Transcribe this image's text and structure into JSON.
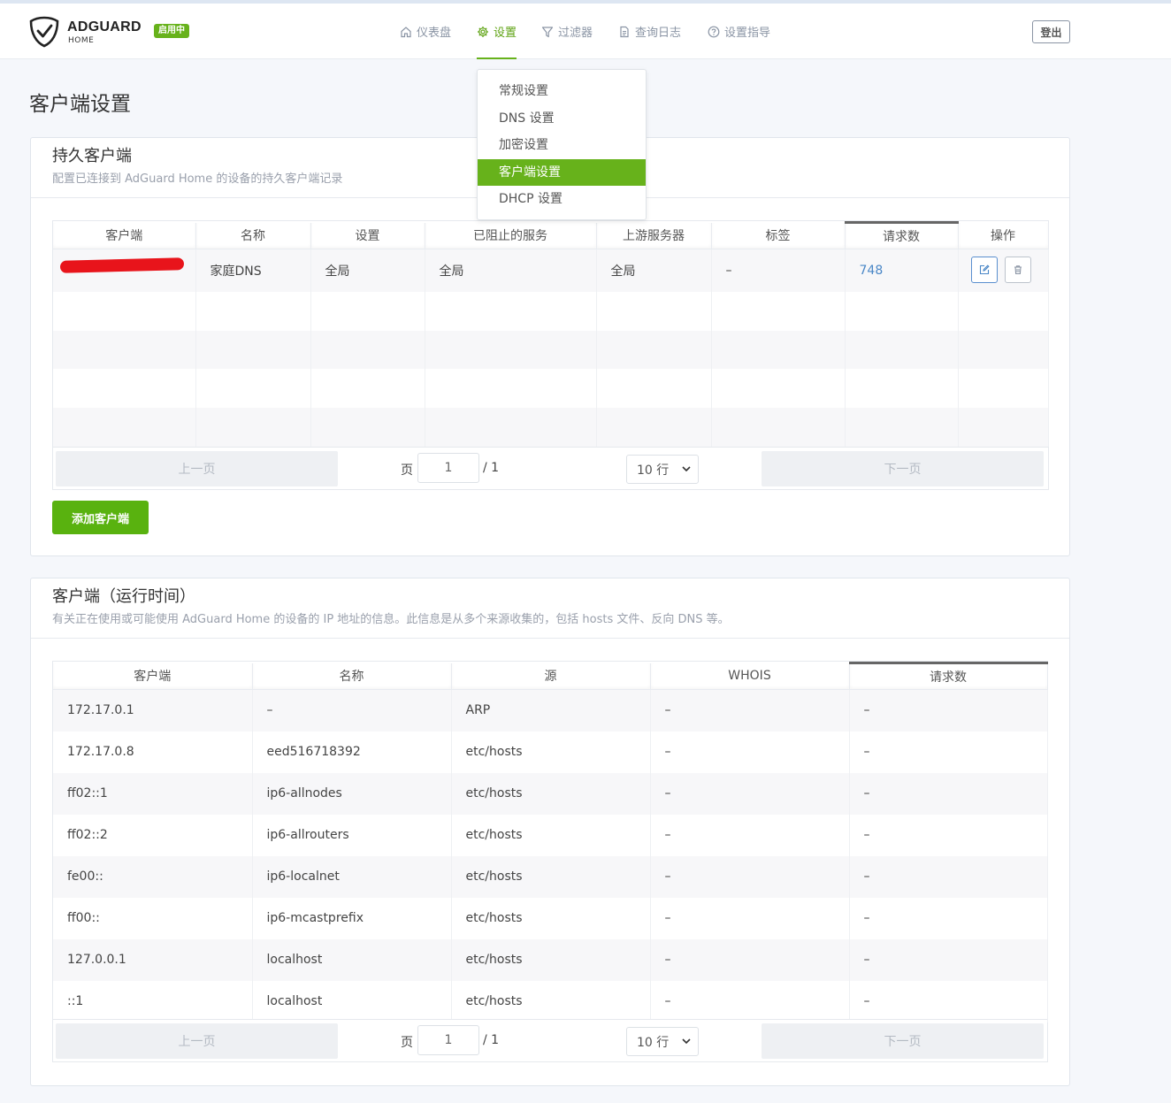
{
  "header": {
    "brand": "ADGUARD",
    "brand_sub": "HOME",
    "status_badge": "启用中",
    "nav": [
      {
        "label": "仪表盘",
        "icon": "home-icon"
      },
      {
        "label": "设置",
        "icon": "gear-icon",
        "active": true
      },
      {
        "label": "过滤器",
        "icon": "filter-icon"
      },
      {
        "label": "查询日志",
        "icon": "document-icon"
      },
      {
        "label": "设置指导",
        "icon": "help-icon"
      }
    ],
    "logout": "登出",
    "accent_color": "#67b21b"
  },
  "settings_menu": [
    {
      "label": "常规设置"
    },
    {
      "label": "DNS 设置"
    },
    {
      "label": "加密设置"
    },
    {
      "label": "客户端设置",
      "active": true
    },
    {
      "label": "DHCP 设置"
    }
  ],
  "page_title": "客户端设置",
  "persistent": {
    "title": "持久客户端",
    "subtitle": "配置已连接到 AdGuard Home 的设备的持久客户端记录",
    "columns": [
      "客户端",
      "名称",
      "设置",
      "已阻止的服务",
      "上游服务器",
      "标签",
      "请求数",
      "操作"
    ],
    "rows": [
      {
        "client": "",
        "name": "家庭DNS",
        "settings": "全局",
        "blocked": "全局",
        "upstream": "全局",
        "tags": "–",
        "requests": "748"
      }
    ],
    "pager": {
      "prev": "上一页",
      "page_label": "页",
      "page": "1",
      "total": "/ 1",
      "size": "10 行",
      "next": "下一页"
    },
    "add_button": "添加客户端"
  },
  "runtime": {
    "title": "客户端（运行时间）",
    "subtitle": "有关正在使用或可能使用 AdGuard Home 的设备的 IP 地址的信息。此信息是从多个来源收集的，包括 hosts 文件、反向 DNS 等。",
    "columns": [
      "客户端",
      "名称",
      "源",
      "WHOIS",
      "请求数"
    ],
    "rows": [
      {
        "client": "172.17.0.1",
        "name": "–",
        "source": "ARP",
        "whois": "–",
        "requests": "–"
      },
      {
        "client": "172.17.0.8",
        "name": "eed516718392",
        "source": "etc/hosts",
        "whois": "–",
        "requests": "–"
      },
      {
        "client": "ff02::1",
        "name": "ip6-allnodes",
        "source": "etc/hosts",
        "whois": "–",
        "requests": "–"
      },
      {
        "client": "ff02::2",
        "name": "ip6-allrouters",
        "source": "etc/hosts",
        "whois": "–",
        "requests": "–"
      },
      {
        "client": "fe00::",
        "name": "ip6-localnet",
        "source": "etc/hosts",
        "whois": "–",
        "requests": "–"
      },
      {
        "client": "ff00::",
        "name": "ip6-mcastprefix",
        "source": "etc/hosts",
        "whois": "–",
        "requests": "–"
      },
      {
        "client": "127.0.0.1",
        "name": "localhost",
        "source": "etc/hosts",
        "whois": "–",
        "requests": "–"
      },
      {
        "client": "::1",
        "name": "localhost",
        "source": "etc/hosts",
        "whois": "–",
        "requests": "–"
      }
    ],
    "pager": {
      "prev": "上一页",
      "page_label": "页",
      "page": "1",
      "total": "/ 1",
      "size": "10 行",
      "next": "下一页"
    }
  }
}
